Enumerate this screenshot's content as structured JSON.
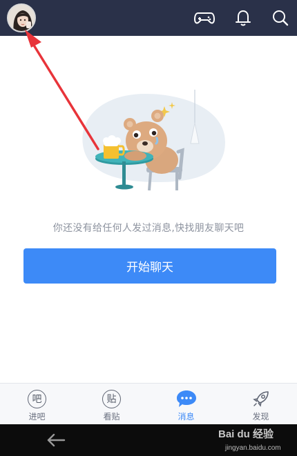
{
  "header": {
    "avatar_label": "user-avatar",
    "icons": [
      "gamepad-icon",
      "bell-icon",
      "search-icon"
    ]
  },
  "empty_state": {
    "message": "你还没有给任何人发过消息,快找朋友聊天吧",
    "illustration": "bear-drinking-beer"
  },
  "start_button": {
    "label": "开始聊天"
  },
  "tabbar": {
    "items": [
      {
        "label": "进吧",
        "glyph": "吧",
        "icon": "ba-icon"
      },
      {
        "label": "看贴",
        "glyph": "贴",
        "icon": "tie-icon"
      },
      {
        "label": "消息",
        "glyph": "•••",
        "icon": "message-icon",
        "active": true
      },
      {
        "label": "发现",
        "glyph": "",
        "icon": "rocket-icon"
      }
    ]
  },
  "watermark": {
    "main": "Bai du 经验",
    "sub": "jingyan.baidu.com"
  },
  "colors": {
    "topbar": "#2a3149",
    "accent": "#3d8af7",
    "arrow": "#e8343a"
  }
}
